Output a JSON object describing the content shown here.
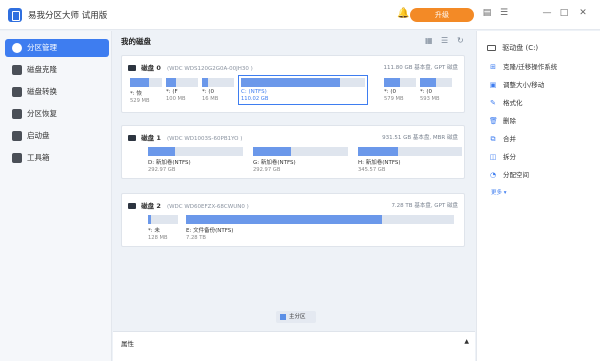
{
  "app": {
    "title": "易我分区大师  试用版",
    "upgrade_label": "升级"
  },
  "colors": {
    "accent": "#3e7df0",
    "upgrade": "#f38a26",
    "partition_used": "#6b98ea",
    "partition_free": "#dfe5ee"
  },
  "titlebar_icons": [
    "bell-icon",
    "feedback-icon",
    "menu-icon",
    "minimize-icon",
    "maximize-icon",
    "close-icon"
  ],
  "sidebar": {
    "items": [
      {
        "label": "分区管理",
        "icon": "partition-icon",
        "active": true
      },
      {
        "label": "磁盘克隆",
        "icon": "clone-icon",
        "active": false
      },
      {
        "label": "磁盘转换",
        "icon": "convert-icon",
        "active": false
      },
      {
        "label": "分区恢复",
        "icon": "recover-icon",
        "active": false
      },
      {
        "label": "启动盘",
        "icon": "bootdisk-icon",
        "active": false
      },
      {
        "label": "工具箱",
        "icon": "toolbox-icon",
        "active": false
      }
    ]
  },
  "main": {
    "title": "我的磁盘",
    "disks": [
      {
        "name": "磁盘 0",
        "model": "(WDC WDS120G2G0A-00JH30 )",
        "info": "111.80 GB 基本盘, GPT 磁盘",
        "partitions": [
          {
            "label": "*: 恢",
            "size": "529 MB",
            "used": 0.6
          },
          {
            "label": "*: (F",
            "size": "100 MB",
            "used": 0.3
          },
          {
            "label": "*: (0",
            "size": "16 MB",
            "used": 0.2
          },
          {
            "label": "C: (NTFS)",
            "size": "110.02 GB",
            "used": 0.8,
            "selected": true
          },
          {
            "label": "*: (0",
            "size": "579 MB",
            "used": 0.5
          },
          {
            "label": "*: (0",
            "size": "593 MB",
            "used": 0.5
          }
        ]
      },
      {
        "name": "磁盘 1",
        "model": "(WDC WD1003S-60PB1YO )",
        "info": "931.51 GB 基本盘, MBR 磁盘",
        "partitions": [
          {
            "label": "D: 新加卷(NTFS)",
            "size": "292.97 GB",
            "used": 0.28
          },
          {
            "label": "G: 新加卷(NTFS)",
            "size": "292.97 GB",
            "used": 0.4
          },
          {
            "label": "H: 新加卷(NTFS)",
            "size": "345.57 GB",
            "used": 0.38
          }
        ]
      },
      {
        "name": "磁盘 2",
        "model": "(WDC WD60EFZX-68CWUN0 )",
        "info": "7.28 TB 基本盘, GPT 磁盘",
        "partitions": [
          {
            "label": "*: 未",
            "size": "128 MB",
            "used": 0.1
          },
          {
            "label": "E: 文件备份(NTFS)",
            "size": "7.28 TB",
            "used": 0.73
          },
          {
            "label": "",
            "size": "",
            "used": 0
          }
        ]
      }
    ],
    "legend": "主分区",
    "properties_label": "属性"
  },
  "actions_panel": {
    "disk_label": "驱动盘 (C:)",
    "items": [
      {
        "label": "克隆/迁移操作系统",
        "icon": "windows-icon"
      },
      {
        "label": "调整大小/移动",
        "icon": "resize-icon"
      },
      {
        "label": "格式化",
        "icon": "format-icon"
      },
      {
        "label": "删除",
        "icon": "delete-icon"
      },
      {
        "label": "合并",
        "icon": "merge-icon"
      },
      {
        "label": "拆分",
        "icon": "split-icon"
      },
      {
        "label": "分配空间",
        "icon": "allocate-icon"
      }
    ],
    "more_label": "更多 ▾"
  }
}
